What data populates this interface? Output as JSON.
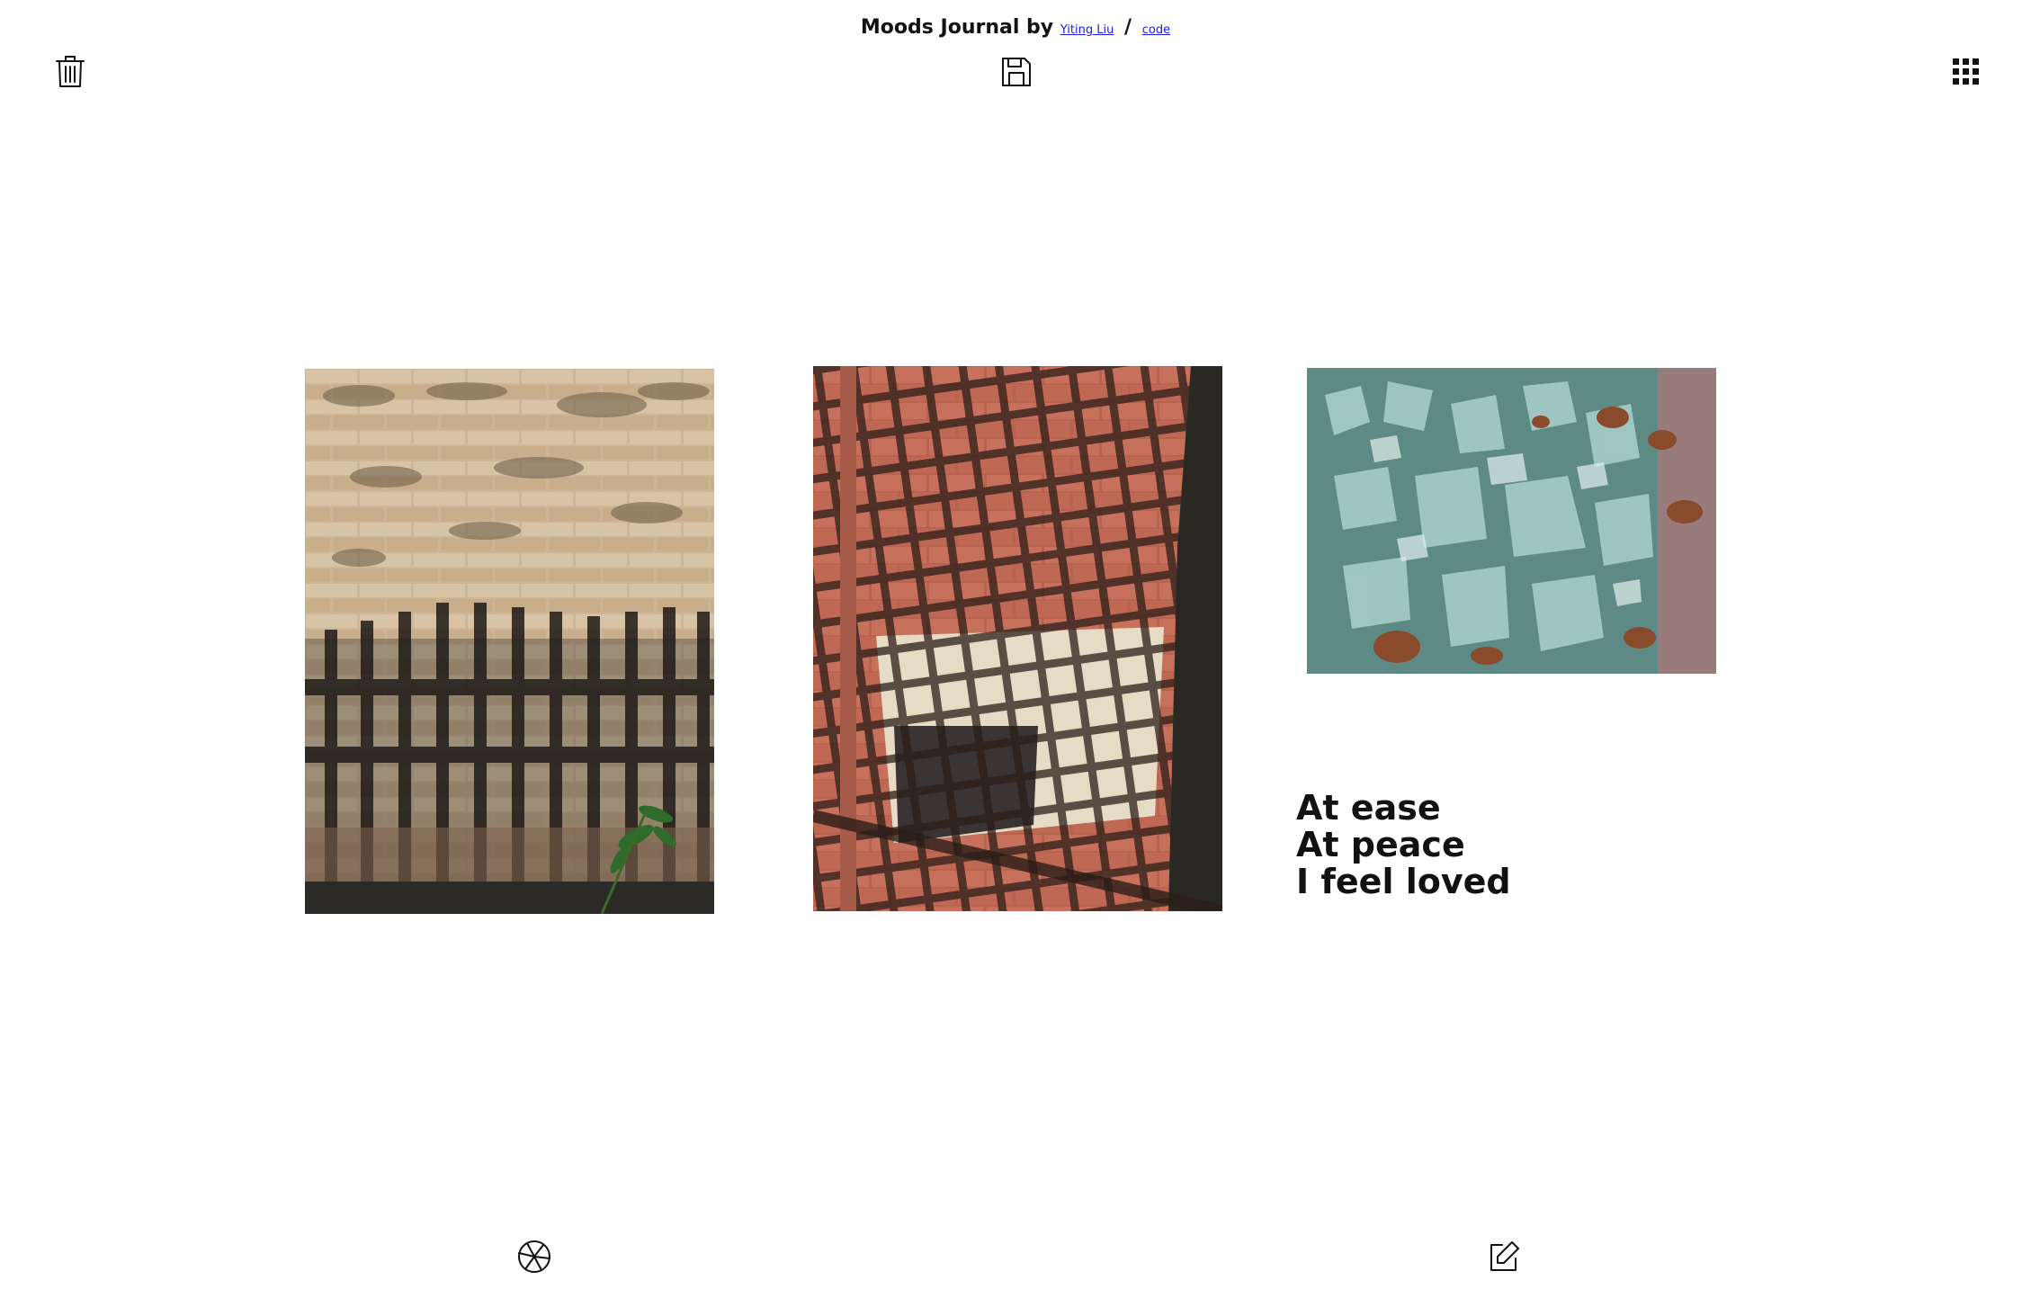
{
  "header": {
    "title": "Moods Journal by",
    "author_link": "Yiting Liu",
    "separator": "/",
    "code_link": "code"
  },
  "toolbar": {
    "icons": [
      "trash-icon",
      "save-icon",
      "grid-icon",
      "camera-aperture-icon",
      "edit-icon"
    ]
  },
  "journal": {
    "photos": [
      {
        "name": "brick-wall-fence-shadow"
      },
      {
        "name": "brick-wall-grid-shadow"
      },
      {
        "name": "broken-glass-shards"
      }
    ],
    "mood_lines": [
      "At ease",
      "At peace",
      "I feel loved"
    ]
  },
  "colors": {
    "background": "#ffffff",
    "text": "#111111",
    "link": "#1a1ae6"
  }
}
